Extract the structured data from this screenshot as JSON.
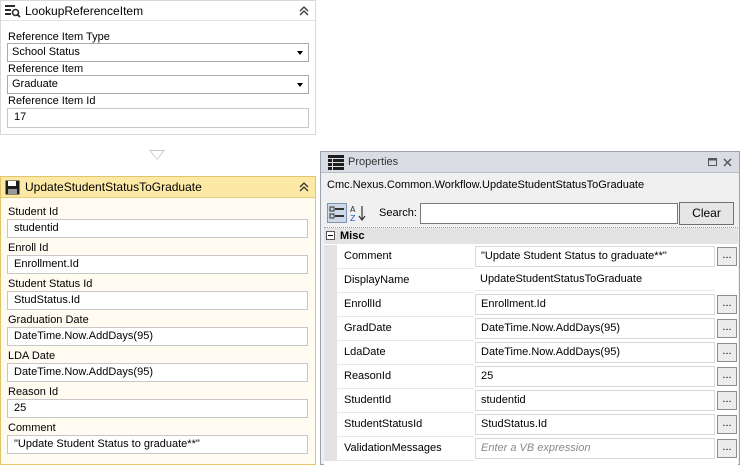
{
  "lookup": {
    "title": "LookupReferenceItem",
    "fields": {
      "type_label": "Reference Item Type",
      "type_value": "School Status",
      "item_label": "Reference Item",
      "item_value": "Graduate",
      "id_label": "Reference Item Id",
      "id_value": "17"
    }
  },
  "update": {
    "title": "UpdateStudentStatusToGraduate",
    "fields": [
      {
        "label": "Student Id",
        "value": "studentid"
      },
      {
        "label": "Enroll Id",
        "value": "Enrollment.Id"
      },
      {
        "label": "Student Status Id",
        "value": "StudStatus.Id"
      },
      {
        "label": "Graduation Date",
        "value": "DateTime.Now.AddDays(95)"
      },
      {
        "label": "LDA Date",
        "value": "DateTime.Now.AddDays(95)"
      },
      {
        "label": "Reason Id",
        "value": "25"
      },
      {
        "label": "Comment",
        "value": "\"Update Student Status to graduate**\""
      }
    ]
  },
  "properties": {
    "title": "Properties",
    "type_name": "Cmc.Nexus.Common.Workflow.UpdateStudentStatusToGraduate",
    "search_label": "Search:",
    "search_value": "",
    "clear_label": "Clear",
    "category": "Misc",
    "ellipsis": "...",
    "rows": [
      {
        "name": "Comment",
        "value": "\"Update Student Status to graduate**\""
      },
      {
        "name": "DisplayName",
        "value": "UpdateStudentStatusToGraduate"
      },
      {
        "name": "EnrollId",
        "value": "Enrollment.Id"
      },
      {
        "name": "GradDate",
        "value": "DateTime.Now.AddDays(95)"
      },
      {
        "name": "LdaDate",
        "value": "DateTime.Now.AddDays(95)"
      },
      {
        "name": "ReasonId",
        "value": "25"
      },
      {
        "name": "StudentId",
        "value": "studentid"
      },
      {
        "name": "StudentStatusId",
        "value": "StudStatus.Id"
      },
      {
        "name": "ValidationMessages",
        "value": "Enter a VB expression"
      }
    ]
  },
  "colors": {
    "selected_header": "#fde9a6",
    "selected_border": "#e2c46a",
    "panel_title": "#d9dde3"
  }
}
